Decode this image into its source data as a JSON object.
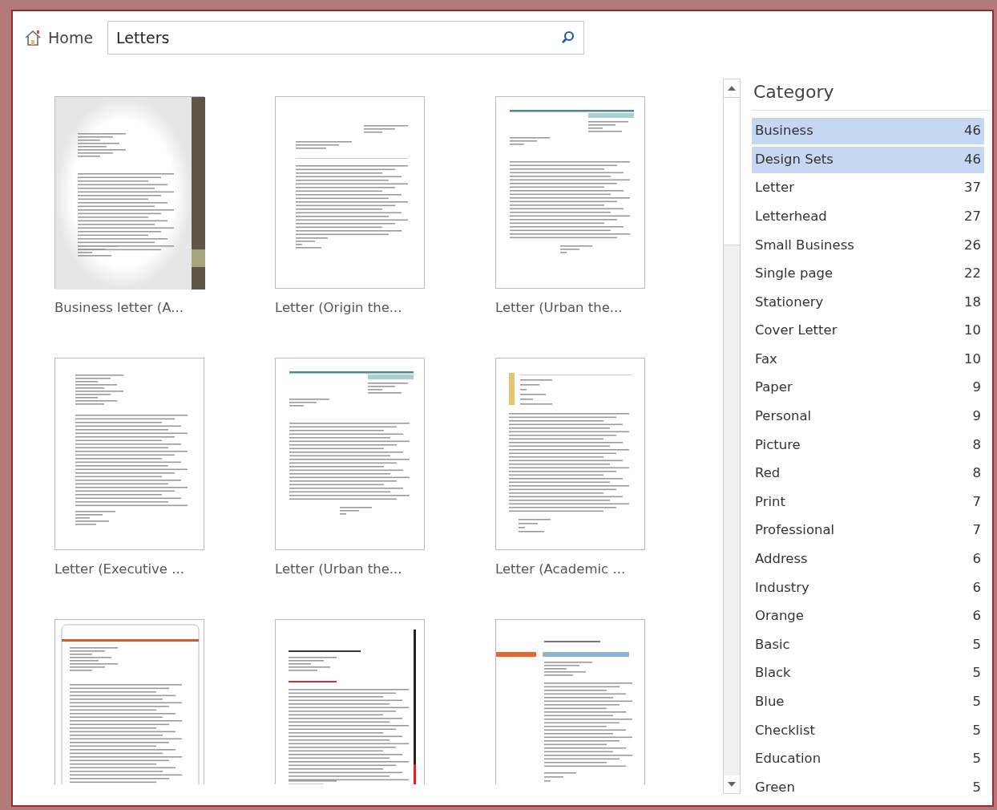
{
  "nav": {
    "home": "Home"
  },
  "search": {
    "value": "Letters"
  },
  "templates": [
    {
      "name": "Business letter (A...",
      "kind": "sidebar"
    },
    {
      "name": "Letter (Origin the...",
      "kind": "origin"
    },
    {
      "name": "Letter (Urban the...",
      "kind": "urban"
    },
    {
      "name": "Letter (Executive ...",
      "kind": "plain"
    },
    {
      "name": "Letter (Urban the...",
      "kind": "urban"
    },
    {
      "name": "Letter (Academic ...",
      "kind": "academic"
    },
    {
      "kind": "redband"
    },
    {
      "kind": "redline"
    },
    {
      "kind": "orange"
    }
  ],
  "category": {
    "title": "Category",
    "items": [
      {
        "name": "Business",
        "count": "46",
        "selected": true
      },
      {
        "name": "Design Sets",
        "count": "46",
        "selected": true
      },
      {
        "name": "Letter",
        "count": "37",
        "selected": false
      },
      {
        "name": "Letterhead",
        "count": "27",
        "selected": false
      },
      {
        "name": "Small Business",
        "count": "26",
        "selected": false
      },
      {
        "name": "Single page",
        "count": "22",
        "selected": false
      },
      {
        "name": "Stationery",
        "count": "18",
        "selected": false
      },
      {
        "name": "Cover Letter",
        "count": "10",
        "selected": false
      },
      {
        "name": "Fax",
        "count": "10",
        "selected": false
      },
      {
        "name": "Paper",
        "count": "9",
        "selected": false
      },
      {
        "name": "Personal",
        "count": "9",
        "selected": false
      },
      {
        "name": "Picture",
        "count": "8",
        "selected": false
      },
      {
        "name": "Red",
        "count": "8",
        "selected": false
      },
      {
        "name": "Print",
        "count": "7",
        "selected": false
      },
      {
        "name": "Professional",
        "count": "7",
        "selected": false
      },
      {
        "name": "Address",
        "count": "6",
        "selected": false
      },
      {
        "name": "Industry",
        "count": "6",
        "selected": false
      },
      {
        "name": "Orange",
        "count": "6",
        "selected": false
      },
      {
        "name": "Basic",
        "count": "5",
        "selected": false
      },
      {
        "name": "Black",
        "count": "5",
        "selected": false
      },
      {
        "name": "Blue",
        "count": "5",
        "selected": false
      },
      {
        "name": "Checklist",
        "count": "5",
        "selected": false
      },
      {
        "name": "Education",
        "count": "5",
        "selected": false
      },
      {
        "name": "Green",
        "count": "5",
        "selected": false
      }
    ]
  }
}
